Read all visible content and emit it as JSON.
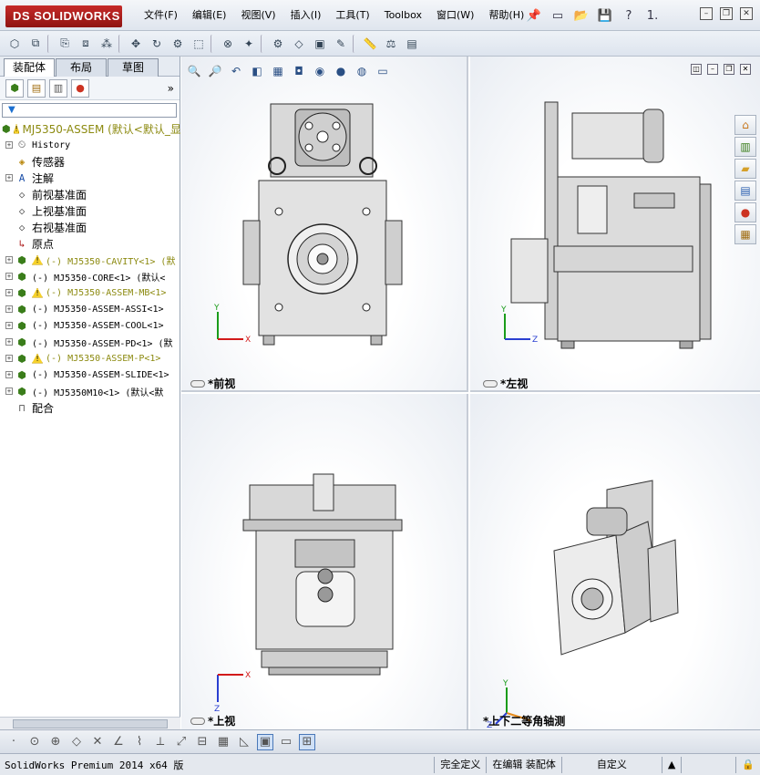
{
  "app": {
    "logo_text": "SOLIDWORKS",
    "logo_prefix": "DS"
  },
  "menu": [
    "文件(F)",
    "编辑(E)",
    "视图(V)",
    "插入(I)",
    "工具(T)",
    "Toolbox",
    "窗口(W)",
    "帮助(H)"
  ],
  "menu_tools": {
    "help_badge": "?",
    "version_hint": "1."
  },
  "left_panel": {
    "tabs": [
      "装配体",
      "布局",
      "草图"
    ],
    "active_tab": "装配体",
    "more_glyph": "»",
    "tree": [
      {
        "label": "MJ5350-ASSEM  (默认<默认_显",
        "icon": "asm",
        "warn": true,
        "color": "yellow",
        "expand": false,
        "indent": 0
      },
      {
        "label": "History",
        "icon": "history",
        "warn": false,
        "color": "black",
        "expand": true,
        "indent": 1
      },
      {
        "label": "传感器",
        "icon": "sensor",
        "warn": false,
        "color": "black",
        "expand": false,
        "indent": 1
      },
      {
        "label": "注解",
        "icon": "annot",
        "warn": false,
        "color": "black",
        "expand": true,
        "indent": 1
      },
      {
        "label": "前视基准面",
        "icon": "plane",
        "warn": false,
        "color": "black",
        "expand": false,
        "indent": 1
      },
      {
        "label": "上视基准面",
        "icon": "plane",
        "warn": false,
        "color": "black",
        "expand": false,
        "indent": 1
      },
      {
        "label": "右视基准面",
        "icon": "plane",
        "warn": false,
        "color": "black",
        "expand": false,
        "indent": 1
      },
      {
        "label": "原点",
        "icon": "origin",
        "warn": false,
        "color": "black",
        "expand": false,
        "indent": 1
      },
      {
        "label": "(-) MJ5350-CAVITY<1> (默",
        "icon": "asm",
        "warn": true,
        "color": "yellow",
        "expand": true,
        "indent": 1
      },
      {
        "label": "(-) MJ5350-CORE<1> (默认<",
        "icon": "asm",
        "warn": false,
        "color": "black",
        "expand": true,
        "indent": 1
      },
      {
        "label": "(-) MJ5350-ASSEM-MB<1>",
        "icon": "asm",
        "warn": true,
        "color": "yellow",
        "expand": true,
        "indent": 1
      },
      {
        "label": "(-) MJ5350-ASSEM-ASSI<1>",
        "icon": "asm",
        "warn": false,
        "color": "black",
        "expand": true,
        "indent": 1
      },
      {
        "label": "(-) MJ5350-ASSEM-COOL<1>",
        "icon": "asm",
        "warn": false,
        "color": "black",
        "expand": true,
        "indent": 1
      },
      {
        "label": "(-) MJ5350-ASSEM-PD<1> (默",
        "icon": "asm",
        "warn": false,
        "color": "black",
        "expand": true,
        "indent": 1
      },
      {
        "label": "(-) MJ5350-ASSEM-P<1>",
        "icon": "asm",
        "warn": true,
        "color": "yellow",
        "expand": true,
        "indent": 1
      },
      {
        "label": "(-) MJ5350-ASSEM-SLIDE<1>",
        "icon": "asm",
        "warn": false,
        "color": "black",
        "expand": true,
        "indent": 1
      },
      {
        "label": "(-) MJ5350M10<1> (默认<默",
        "icon": "asm",
        "warn": false,
        "color": "black",
        "expand": true,
        "indent": 1
      },
      {
        "label": "配合",
        "icon": "mate",
        "warn": false,
        "color": "black",
        "expand": false,
        "indent": 1
      }
    ]
  },
  "views": {
    "front": "*前视",
    "left": "*左视",
    "top": "*上视",
    "iso": "*上下二等角轴测"
  },
  "axes": {
    "x": "X",
    "y": "Y",
    "z": "Z"
  },
  "status": {
    "left": "SolidWorks Premium 2014 x64 版",
    "cells": [
      "完全定义",
      "在编辑 装配体",
      "自定义"
    ],
    "caret": "▲"
  },
  "colors": {
    "accent": "#c62a28",
    "warn": "#f6d12b",
    "yellow_text": "#8c8a10",
    "viewport_bg": "#eaedf2"
  }
}
